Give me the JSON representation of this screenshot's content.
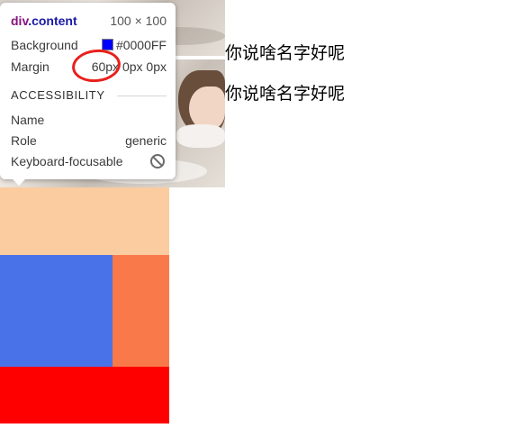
{
  "page_text": {
    "line1": "你说啥名字好呢",
    "line2": "你说啥名字好呢"
  },
  "tooltip": {
    "tag": "div",
    "class_name": ".content",
    "size": "100 × 100",
    "background_label": "Background",
    "background_value": "#0000FF",
    "margin_label": "Margin",
    "margin_values": [
      "60px",
      "0px",
      "0px"
    ],
    "accessibility_heading": "ACCESSIBILITY",
    "name_label": "Name",
    "name_value": "",
    "role_label": "Role",
    "role_value": "generic",
    "keyboard_label": "Keyboard-focusable"
  },
  "colors": {
    "swatch": "#0000FF",
    "peach": "#FACCA0",
    "blue": "#4A72E8",
    "orange": "#F9794A",
    "red": "#FF0000",
    "annotation": "#E8201C"
  },
  "icons": {
    "keyboard_focusable": "not-allowed-icon"
  }
}
